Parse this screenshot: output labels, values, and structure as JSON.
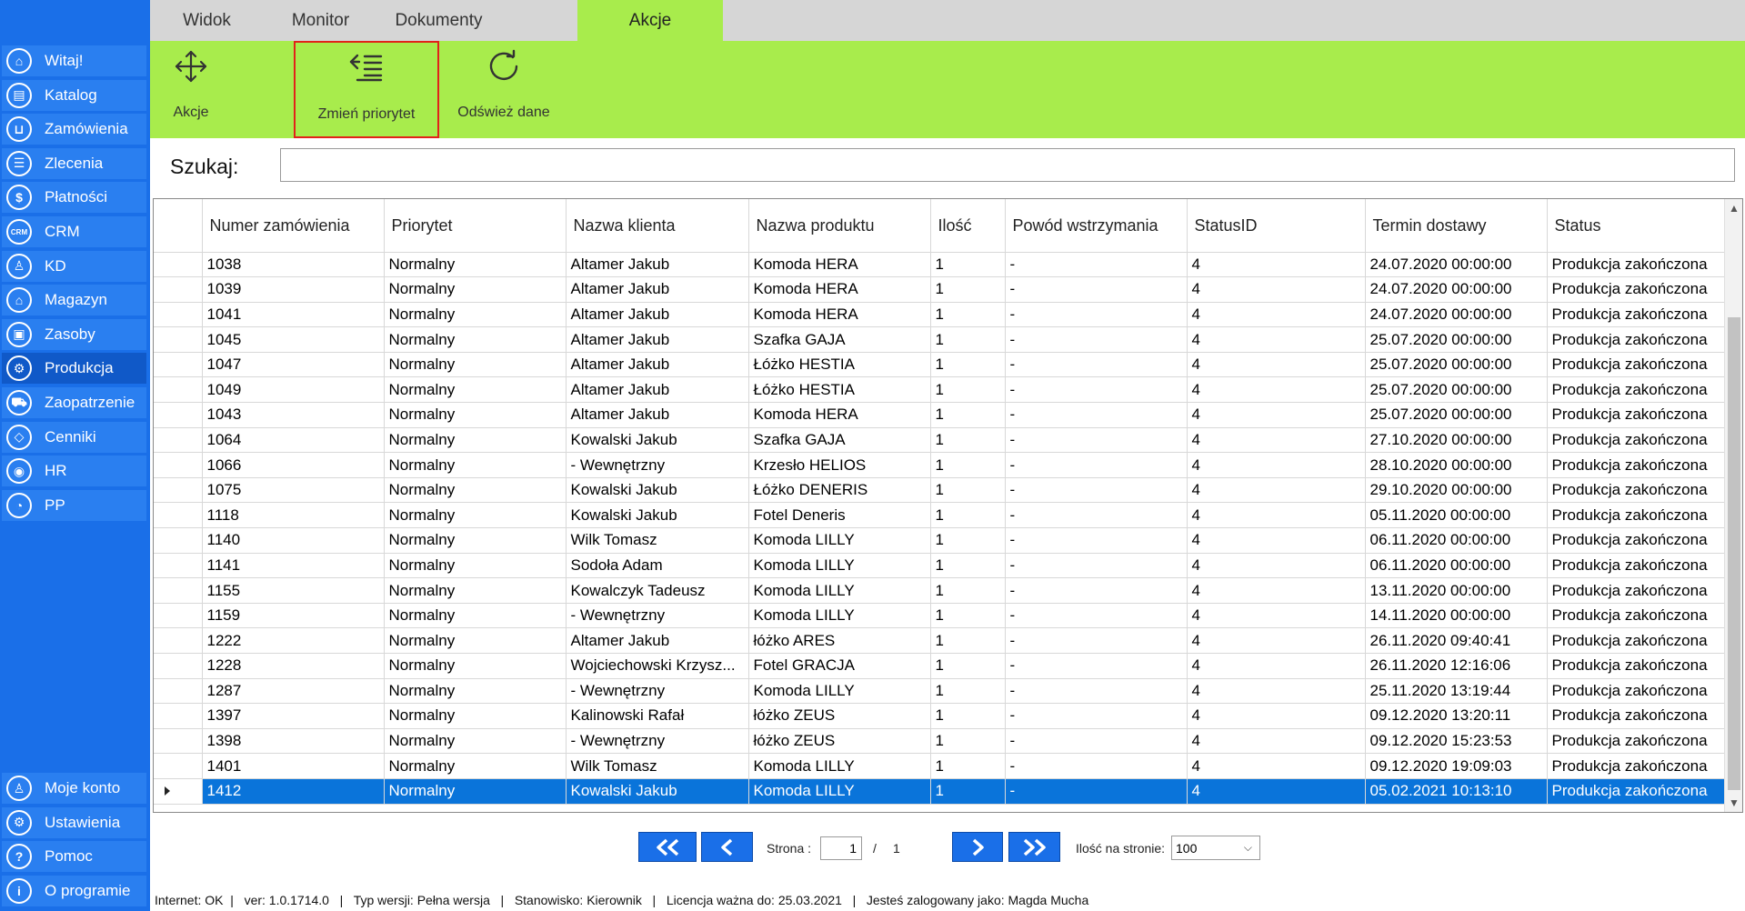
{
  "sidebar": {
    "items": [
      {
        "label": "Witaj!",
        "icon": "home-icon",
        "glyph": "⌂"
      },
      {
        "label": "Katalog",
        "icon": "book-icon",
        "glyph": "▤"
      },
      {
        "label": "Zamówienia",
        "icon": "cart-icon",
        "glyph": "⊔"
      },
      {
        "label": "Zlecenia",
        "icon": "list-icon",
        "glyph": "☰"
      },
      {
        "label": "Płatności",
        "icon": "dollar-icon",
        "glyph": "$"
      },
      {
        "label": "CRM",
        "icon": "crm-icon",
        "glyph": "CRM"
      },
      {
        "label": "KD",
        "icon": "person-icon",
        "glyph": "♙"
      },
      {
        "label": "Magazyn",
        "icon": "warehouse-icon",
        "glyph": "⌂"
      },
      {
        "label": "Zasoby",
        "icon": "box-icon",
        "glyph": "▣"
      },
      {
        "label": "Produkcja",
        "icon": "production-icon",
        "glyph": "⚙"
      },
      {
        "label": "Zaopatrzenie",
        "icon": "truck-icon",
        "glyph": "⛟"
      },
      {
        "label": "Cenniki",
        "icon": "tag-icon",
        "glyph": "◇"
      },
      {
        "label": "HR",
        "icon": "hr-icon",
        "glyph": "◉"
      },
      {
        "label": "PP",
        "icon": "pp-icon",
        "glyph": "◔"
      }
    ],
    "bottom_items": [
      {
        "label": "Moje konto",
        "icon": "user-icon",
        "glyph": "♙"
      },
      {
        "label": "Ustawienia",
        "icon": "gear-icon",
        "glyph": "⚙"
      },
      {
        "label": "Pomoc",
        "icon": "help-icon",
        "glyph": "?"
      },
      {
        "label": "O programie",
        "icon": "info-icon",
        "glyph": "i"
      }
    ]
  },
  "tabs": [
    "Widok",
    "Monitor",
    "Dokumenty",
    "Akcje"
  ],
  "ribbon": {
    "actions_label": "Akcje",
    "change_priority_label": "Zmień priorytet",
    "refresh_label": "Odśwież dane"
  },
  "search": {
    "label": "Szukaj:",
    "value": ""
  },
  "table": {
    "headers": [
      "Numer zamówienia",
      "Priorytet",
      "Nazwa klienta",
      "Nazwa produktu",
      "Ilość",
      "Powód wstrzymania",
      "StatusID",
      "Termin dostawy",
      "Status"
    ],
    "rows": [
      [
        "1038",
        "Normalny",
        "Altamer Jakub",
        "Komoda HERA",
        "1",
        "-",
        "4",
        "24.07.2020 00:00:00",
        "Produkcja zakończona"
      ],
      [
        "1039",
        "Normalny",
        "Altamer Jakub",
        "Komoda HERA",
        "1",
        "-",
        "4",
        "24.07.2020 00:00:00",
        "Produkcja zakończona"
      ],
      [
        "1041",
        "Normalny",
        "Altamer Jakub",
        "Komoda HERA",
        "1",
        "-",
        "4",
        "24.07.2020 00:00:00",
        "Produkcja zakończona"
      ],
      [
        "1045",
        "Normalny",
        "Altamer Jakub",
        "Szafka GAJA",
        "1",
        "-",
        "4",
        "25.07.2020 00:00:00",
        "Produkcja zakończona"
      ],
      [
        "1047",
        "Normalny",
        "Altamer Jakub",
        "Łóżko HESTIA",
        "1",
        "-",
        "4",
        "25.07.2020 00:00:00",
        "Produkcja zakończona"
      ],
      [
        "1049",
        "Normalny",
        "Altamer Jakub",
        "Łóżko HESTIA",
        "1",
        "-",
        "4",
        "25.07.2020 00:00:00",
        "Produkcja zakończona"
      ],
      [
        "1043",
        "Normalny",
        "Altamer Jakub",
        "Komoda HERA",
        "1",
        "-",
        "4",
        "25.07.2020 00:00:00",
        "Produkcja zakończona"
      ],
      [
        "1064",
        "Normalny",
        "Kowalski Jakub",
        "Szafka GAJA",
        "1",
        "-",
        "4",
        "27.10.2020 00:00:00",
        "Produkcja zakończona"
      ],
      [
        "1066",
        "Normalny",
        "- Wewnętrzny",
        "Krzesło HELIOS",
        "1",
        "-",
        "4",
        "28.10.2020 00:00:00",
        "Produkcja zakończona"
      ],
      [
        "1075",
        "Normalny",
        "Kowalski Jakub",
        "Łóżko DENERIS",
        "1",
        "-",
        "4",
        "29.10.2020 00:00:00",
        "Produkcja zakończona"
      ],
      [
        "1118",
        "Normalny",
        "Kowalski Jakub",
        "Fotel Deneris",
        "1",
        "-",
        "4",
        "05.11.2020 00:00:00",
        "Produkcja zakończona"
      ],
      [
        "1140",
        "Normalny",
        "Wilk Tomasz",
        "Komoda LILLY",
        "1",
        "-",
        "4",
        "06.11.2020 00:00:00",
        "Produkcja zakończona"
      ],
      [
        "1141",
        "Normalny",
        "Sodoła  Adam",
        "Komoda LILLY",
        "1",
        "-",
        "4",
        "06.11.2020 00:00:00",
        "Produkcja zakończona"
      ],
      [
        "1155",
        "Normalny",
        "Kowalczyk Tadeusz",
        "Komoda LILLY",
        "1",
        "-",
        "4",
        "13.11.2020 00:00:00",
        "Produkcja zakończona"
      ],
      [
        "1159",
        "Normalny",
        "- Wewnętrzny",
        "Komoda LILLY",
        "1",
        "-",
        "4",
        "14.11.2020 00:00:00",
        "Produkcja zakończona"
      ],
      [
        "1222",
        "Normalny",
        "Altamer Jakub",
        "łóżko ARES",
        "1",
        "-",
        "4",
        "26.11.2020 09:40:41",
        "Produkcja zakończona"
      ],
      [
        "1228",
        "Normalny",
        "Wojciechowski Krzysz...",
        "Fotel GRACJA",
        "1",
        "-",
        "4",
        "26.11.2020 12:16:06",
        "Produkcja zakończona"
      ],
      [
        "1287",
        "Normalny",
        "- Wewnętrzny",
        "Komoda LILLY",
        "1",
        "-",
        "4",
        "25.11.2020 13:19:44",
        "Produkcja zakończona"
      ],
      [
        "1397",
        "Normalny",
        "Kalinowski Rafał",
        "łóżko ZEUS",
        "1",
        "-",
        "4",
        "09.12.2020 13:20:11",
        "Produkcja zakończona"
      ],
      [
        "1398",
        "Normalny",
        "- Wewnętrzny",
        "łóżko ZEUS",
        "1",
        "-",
        "4",
        "09.12.2020 15:23:53",
        "Produkcja zakończona"
      ],
      [
        "1401",
        "Normalny",
        "Wilk Tomasz",
        "Komoda LILLY",
        "1",
        "-",
        "4",
        "09.12.2020 19:09:03",
        "Produkcja zakończona"
      ],
      [
        "1412",
        "Normalny",
        "Kowalski Jakub",
        "Komoda LILLY",
        "1",
        "-",
        "4",
        "05.02.2021 10:13:10",
        "Produkcja zakończona"
      ]
    ],
    "selected_row": 21
  },
  "pager": {
    "page_label": "Strona :",
    "current_page": "1",
    "separator": "/",
    "total_pages": "1",
    "per_page_label": "Ilość na stronie:",
    "per_page_value": "100"
  },
  "statusbar": {
    "text": "Internet: OK  |   ver: 1.0.1714.0   |   Typ wersji: Pełna wersja   |   Stanowisko: Kierownik   |   Licencja ważna do: 25.03.2021   |   Jesteś zalogowany jako: Magda Mucha"
  },
  "colors": {
    "sidebar": "#1a6fe8",
    "ribbon": "#a8ec4c",
    "selection": "#0a74da",
    "highlight_border": "#e2231a"
  }
}
